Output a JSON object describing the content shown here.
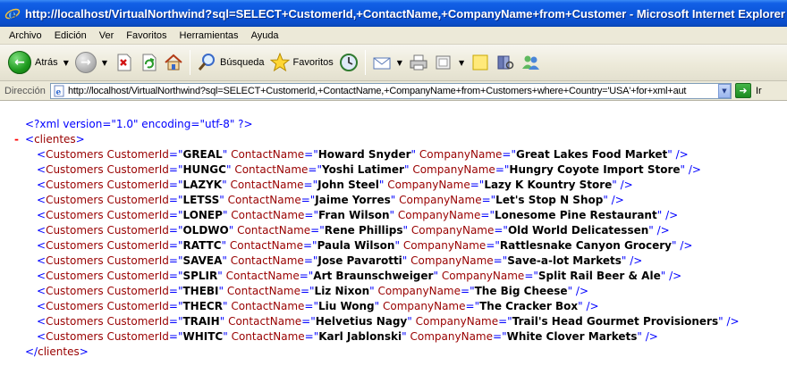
{
  "window": {
    "title": "http://localhost/VirtualNorthwind?sql=SELECT+CustomerId,+ContactName,+CompanyName+from+Customer - Microsoft Internet Explorer"
  },
  "menu": [
    "Archivo",
    "Edición",
    "Ver",
    "Favoritos",
    "Herramientas",
    "Ayuda"
  ],
  "toolbar": {
    "back_label": "Atrás",
    "search_label": "Búsqueda",
    "favorites_label": "Favoritos"
  },
  "address": {
    "label": "Dirección",
    "url": "http://localhost/VirtualNorthwind?sql=SELECT+CustomerId,+ContactName,+CompanyName+from+Customers+where+Country='USA'+for+xml+aut",
    "go_label": "Ir"
  },
  "xml": {
    "declaration": "<?xml version=\"1.0\" encoding=\"utf-8\" ?>",
    "collapse_marker": "-",
    "root_tag": "clientes",
    "element_tag": "Customers",
    "attr_names": [
      "CustomerId",
      "ContactName",
      "CompanyName"
    ],
    "rows": [
      {
        "CustomerId": "GREAL",
        "ContactName": "Howard Snyder",
        "CompanyName": "Great Lakes Food Market"
      },
      {
        "CustomerId": "HUNGC",
        "ContactName": "Yoshi Latimer",
        "CompanyName": "Hungry Coyote Import Store"
      },
      {
        "CustomerId": "LAZYK",
        "ContactName": "John Steel",
        "CompanyName": "Lazy K Kountry Store"
      },
      {
        "CustomerId": "LETSS",
        "ContactName": "Jaime Yorres",
        "CompanyName": "Let's Stop N Shop"
      },
      {
        "CustomerId": "LONEP",
        "ContactName": "Fran Wilson",
        "CompanyName": "Lonesome Pine Restaurant"
      },
      {
        "CustomerId": "OLDWO",
        "ContactName": "Rene Phillips",
        "CompanyName": "Old World Delicatessen"
      },
      {
        "CustomerId": "RATTC",
        "ContactName": "Paula Wilson",
        "CompanyName": "Rattlesnake Canyon Grocery"
      },
      {
        "CustomerId": "SAVEA",
        "ContactName": "Jose Pavarotti",
        "CompanyName": "Save-a-lot Markets"
      },
      {
        "CustomerId": "SPLIR",
        "ContactName": "Art Braunschweiger",
        "CompanyName": "Split Rail Beer & Ale"
      },
      {
        "CustomerId": "THEBI",
        "ContactName": "Liz Nixon",
        "CompanyName": "The Big Cheese"
      },
      {
        "CustomerId": "THECR",
        "ContactName": "Liu Wong",
        "CompanyName": "The Cracker Box"
      },
      {
        "CustomerId": "TRAIH",
        "ContactName": "Helvetius Nagy",
        "CompanyName": "Trail's Head Gourmet Provisioners"
      },
      {
        "CustomerId": "WHITC",
        "ContactName": "Karl Jablonski",
        "CompanyName": "White Clover Markets"
      }
    ]
  },
  "icons": {
    "ie": "ie-logo-icon",
    "back": "back-arrow-icon",
    "forward": "forward-arrow-icon",
    "stop": "stop-icon",
    "refresh": "refresh-icon",
    "home": "home-icon",
    "search": "magnifier-icon",
    "favorites": "star-icon",
    "history": "history-icon",
    "mail": "mail-icon",
    "print": "printer-icon",
    "edit": "edit-icon",
    "discuss": "notes-icon",
    "research": "research-icon",
    "messenger": "messenger-icon"
  },
  "colors": {
    "titlebar": "#0a54d8",
    "chrome": "#ece9d8",
    "xml_tag": "#990000",
    "xml_markup": "#0000ff",
    "collapse": "#ff0000"
  }
}
